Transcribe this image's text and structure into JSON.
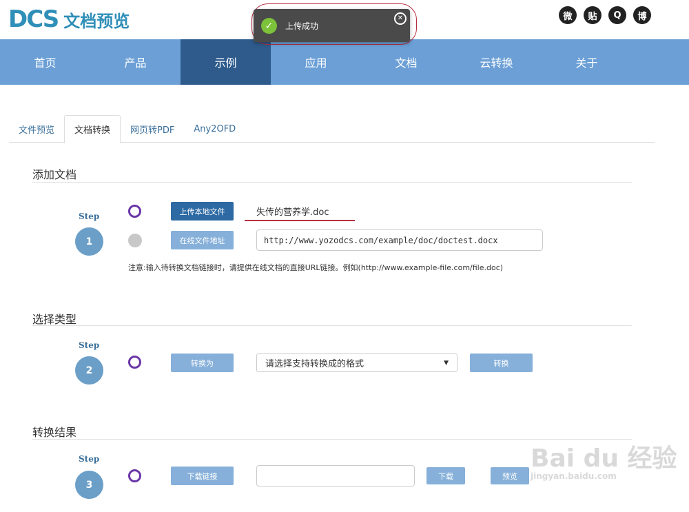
{
  "header": {
    "logo_mark": "DCS",
    "logo_text": "文档预览",
    "social": [
      "微",
      "贴",
      "Q",
      "博"
    ]
  },
  "toast": {
    "message": "上传成功",
    "check_symbol": "✓",
    "close_symbol": "✕"
  },
  "nav": {
    "items": [
      {
        "label": "首页",
        "active": false
      },
      {
        "label": "产品",
        "active": false
      },
      {
        "label": "示例",
        "active": true
      },
      {
        "label": "应用",
        "active": false
      },
      {
        "label": "文档",
        "active": false
      },
      {
        "label": "云转换",
        "active": false
      },
      {
        "label": "关于",
        "active": false
      }
    ]
  },
  "tabs": [
    {
      "label": "文件预览",
      "active": false
    },
    {
      "label": "文档转换",
      "active": true
    },
    {
      "label": "网页转PDF",
      "active": false
    },
    {
      "label": "Any2OFD",
      "active": false
    }
  ],
  "section1": {
    "title": "添加文档",
    "step_label": "Step",
    "step_number": "1",
    "upload_button": "上传本地文件",
    "uploaded_filename": "失传的营养学.doc",
    "url_button": "在线文件地址",
    "url_value": "http://www.yozodcs.com/example/doc/doctest.docx",
    "note": "注意:输入待转换文档链接时，请提供在线文档的直接URL链接。例如(http://www.example-file.com/file.doc)"
  },
  "section2": {
    "title": "选择类型",
    "step_label": "Step",
    "step_number": "2",
    "convert_to_button": "转换为",
    "select_placeholder": "请选择支持转换成的格式",
    "select_caret": "▼",
    "convert_button": "转换"
  },
  "section3": {
    "title": "转换结果",
    "step_label": "Step",
    "step_number": "3",
    "download_link_button": "下载链接",
    "download_button": "下载",
    "preview_button": "预览"
  },
  "watermark": {
    "main": "Bai du 经验",
    "sub": "jingyan.baidu.com"
  },
  "colors": {
    "nav_bg": "#6b9fd6",
    "nav_active": "#2e5b8c",
    "brand": "#2f8fb8",
    "radio_accent": "#6a36a8",
    "primary_button": "#2d6aa3",
    "light_button": "#86b0d9",
    "annotation_red": "#b83040"
  }
}
